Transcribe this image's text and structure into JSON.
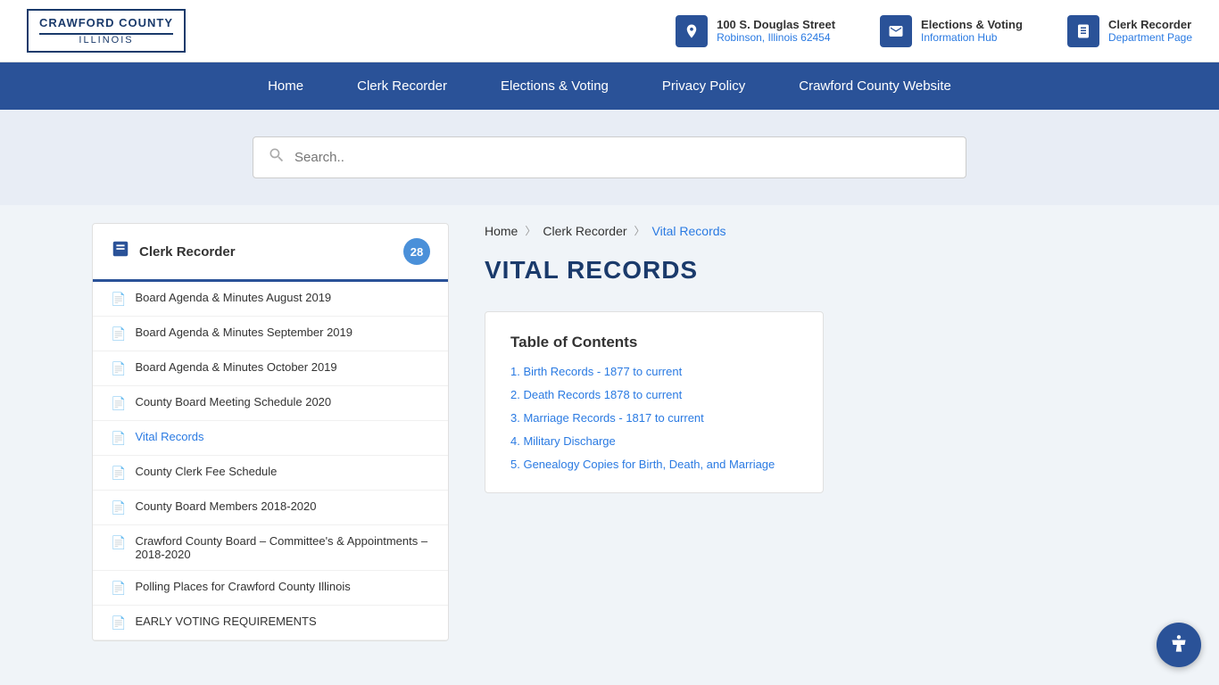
{
  "logo": {
    "top": "CRAWFORD COUNTY",
    "bottom": "ILLINOIS"
  },
  "header": {
    "address_line1": "100 S. Douglas Street",
    "address_line2": "Robinson, Illinois 62454",
    "elections_line1": "Elections & Voting",
    "elections_line2": "Information Hub",
    "clerk_line1": "Clerk Recorder",
    "clerk_line2": "Department Page"
  },
  "nav": {
    "items": [
      "Home",
      "Clerk Recorder",
      "Elections & Voting",
      "Privacy Policy",
      "Crawford County Website"
    ]
  },
  "search": {
    "placeholder": "Search.."
  },
  "sidebar": {
    "title": "Clerk Recorder",
    "badge": "28",
    "items": [
      {
        "label": "Board Agenda & Minutes August 2019",
        "active": false
      },
      {
        "label": "Board Agenda & Minutes September 2019",
        "active": false
      },
      {
        "label": "Board Agenda & Minutes October 2019",
        "active": false
      },
      {
        "label": "County Board Meeting Schedule 2020",
        "active": false
      },
      {
        "label": "Vital Records",
        "active": true
      },
      {
        "label": "County Clerk Fee Schedule",
        "active": false
      },
      {
        "label": "County Board Members 2018-2020",
        "active": false
      },
      {
        "label": "Crawford County Board – Committee's & Appointments – 2018-2020",
        "active": false
      },
      {
        "label": "Polling Places for Crawford County Illinois",
        "active": false
      },
      {
        "label": "EARLY VOTING REQUIREMENTS",
        "active": false
      }
    ]
  },
  "breadcrumb": {
    "items": [
      "Home",
      "Clerk Recorder",
      "Vital Records"
    ]
  },
  "page_title": "VITAL RECORDS",
  "toc": {
    "title": "Table of Contents",
    "items": [
      "1. Birth Records - 1877 to current",
      "2. Death Records 1878 to current",
      "3. Marriage Records - 1817 to current",
      "4. Military Discharge",
      "5. Genealogy Copies for Birth, Death, and Marriage"
    ]
  }
}
